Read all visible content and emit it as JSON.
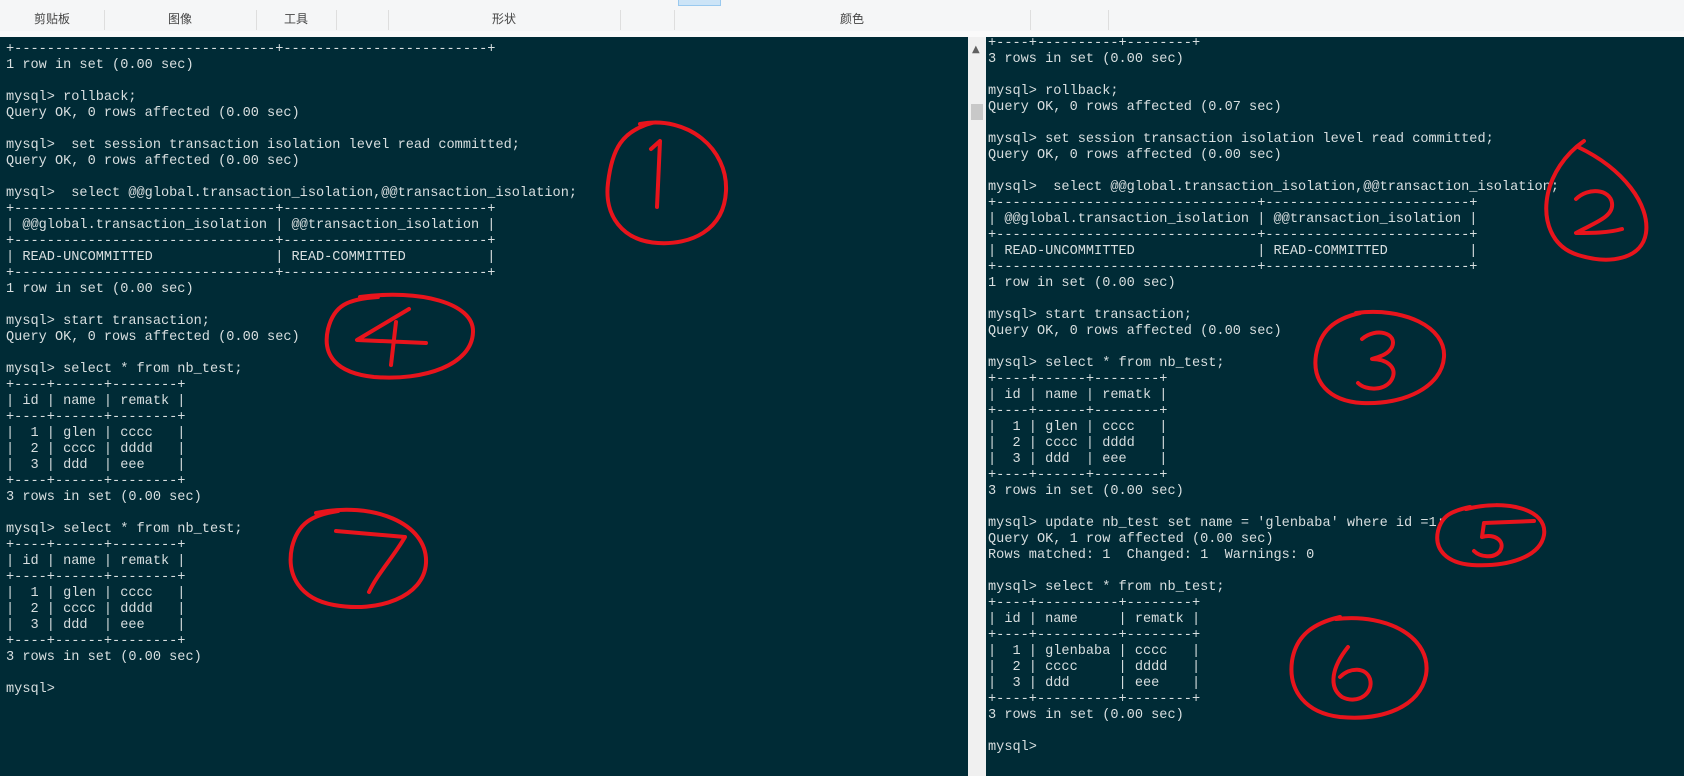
{
  "ribbon": {
    "groups": [
      "剪贴板",
      "图像",
      "工具",
      "",
      "形状",
      "",
      "颜色",
      ""
    ]
  },
  "left_terminal": {
    "lines": [
      "+--------------------------------+-------------------------+",
      "1 row in set (0.00 sec)",
      "",
      "mysql> rollback;",
      "Query OK, 0 rows affected (0.00 sec)",
      "",
      "mysql>  set session transaction isolation level read committed;",
      "Query OK, 0 rows affected (0.00 sec)",
      "",
      "mysql>  select @@global.transaction_isolation,@@transaction_isolation;",
      "+--------------------------------+-------------------------+",
      "| @@global.transaction_isolation | @@transaction_isolation |",
      "+--------------------------------+-------------------------+",
      "| READ-UNCOMMITTED               | READ-COMMITTED          |",
      "+--------------------------------+-------------------------+",
      "1 row in set (0.00 sec)",
      "",
      "mysql> start transaction;",
      "Query OK, 0 rows affected (0.00 sec)",
      "",
      "mysql> select * from nb_test;",
      "+----+------+--------+",
      "| id | name | rematk |",
      "+----+------+--------+",
      "|  1 | glen | cccc   |",
      "|  2 | cccc | dddd   |",
      "|  3 | ddd  | eee    |",
      "+----+------+--------+",
      "3 rows in set (0.00 sec)",
      "",
      "mysql> select * from nb_test;",
      "+----+------+--------+",
      "| id | name | rematk |",
      "+----+------+--------+",
      "|  1 | glen | cccc   |",
      "|  2 | cccc | dddd   |",
      "|  3 | ddd  | eee    |",
      "+----+------+--------+",
      "3 rows in set (0.00 sec)",
      "",
      "mysql>"
    ]
  },
  "right_terminal": {
    "lines": [
      "+----+----------+--------+",
      "3 rows in set (0.00 sec)",
      "",
      "mysql> rollback;",
      "Query OK, 0 rows affected (0.07 sec)",
      "",
      "mysql> set session transaction isolation level read committed;",
      "Query OK, 0 rows affected (0.00 sec)",
      "",
      "mysql>  select @@global.transaction_isolation,@@transaction_isolation;",
      "+--------------------------------+-------------------------+",
      "| @@global.transaction_isolation | @@transaction_isolation |",
      "+--------------------------------+-------------------------+",
      "| READ-UNCOMMITTED               | READ-COMMITTED          |",
      "+--------------------------------+-------------------------+",
      "1 row in set (0.00 sec)",
      "",
      "mysql> start transaction;",
      "Query OK, 0 rows affected (0.00 sec)",
      "",
      "mysql> select * from nb_test;",
      "+----+------+--------+",
      "| id | name | rematk |",
      "+----+------+--------+",
      "|  1 | glen | cccc   |",
      "|  2 | cccc | dddd   |",
      "|  3 | ddd  | eee    |",
      "+----+------+--------+",
      "3 rows in set (0.00 sec)",
      "",
      "mysql> update nb_test set name = 'glenbaba' where id =1;",
      "Query OK, 1 row affected (0.00 sec)",
      "Rows matched: 1  Changed: 1  Warnings: 0",
      "",
      "mysql> select * from nb_test;",
      "+----+----------+--------+",
      "| id | name     | rematk |",
      "+----+----------+--------+",
      "|  1 | glenbaba | cccc   |",
      "|  2 | cccc     | dddd   |",
      "|  3 | ddd      | eee    |",
      "+----+----------+--------+",
      "3 rows in set (0.00 sec)",
      "",
      "mysql>"
    ]
  },
  "annotations": {
    "color": "#e8141c",
    "labels": [
      "1",
      "2",
      "3",
      "4",
      "5",
      "6",
      "7"
    ]
  },
  "colors": {
    "terminal_bg": "#002b36",
    "terminal_text": "#d8dfe0"
  }
}
